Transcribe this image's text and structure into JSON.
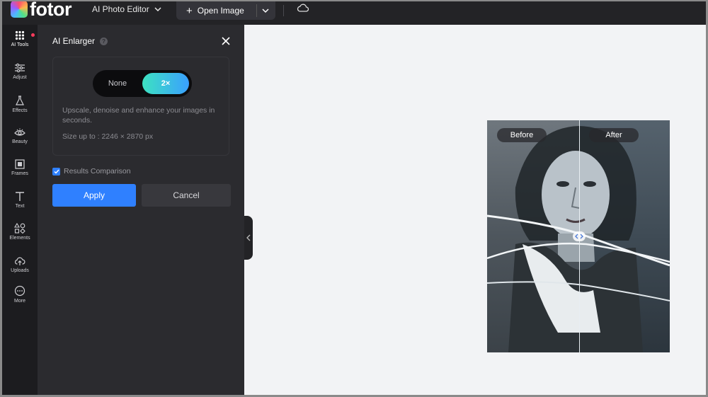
{
  "topbar": {
    "logo_text": "fotor",
    "app_menu_label": "AI Photo Editor",
    "open_image_label": "Open Image"
  },
  "leftnav": {
    "items": [
      {
        "label": "AI Tools",
        "icon": "grid-icon"
      },
      {
        "label": "Adjust",
        "icon": "sliders-icon"
      },
      {
        "label": "Effects",
        "icon": "flask-icon"
      },
      {
        "label": "Beauty",
        "icon": "eye-icon"
      },
      {
        "label": "Frames",
        "icon": "frame-icon"
      },
      {
        "label": "Text",
        "icon": "text-icon"
      },
      {
        "label": "Elements",
        "icon": "shapes-icon"
      },
      {
        "label": "Uploads",
        "icon": "upload-cloud-icon"
      },
      {
        "label": "More",
        "icon": "more-icon"
      }
    ]
  },
  "panel": {
    "title": "AI Enlarger",
    "help_glyph": "?",
    "toggle": {
      "none_label": "None",
      "selected_label": "2×"
    },
    "description": "Upscale, denoise and enhance your images in seconds.",
    "size_text": "Size up to : 2246 × 2870 px",
    "compare_label": "Results Comparison",
    "apply_label": "Apply",
    "cancel_label": "Cancel"
  },
  "canvas": {
    "before_label": "Before",
    "after_label": "After"
  },
  "colors": {
    "accent": "#2f80ff",
    "toggle_gradient_start": "#3de2c1",
    "toggle_gradient_end": "#3aa0ff",
    "notification_dot": "#ff3b5c"
  }
}
